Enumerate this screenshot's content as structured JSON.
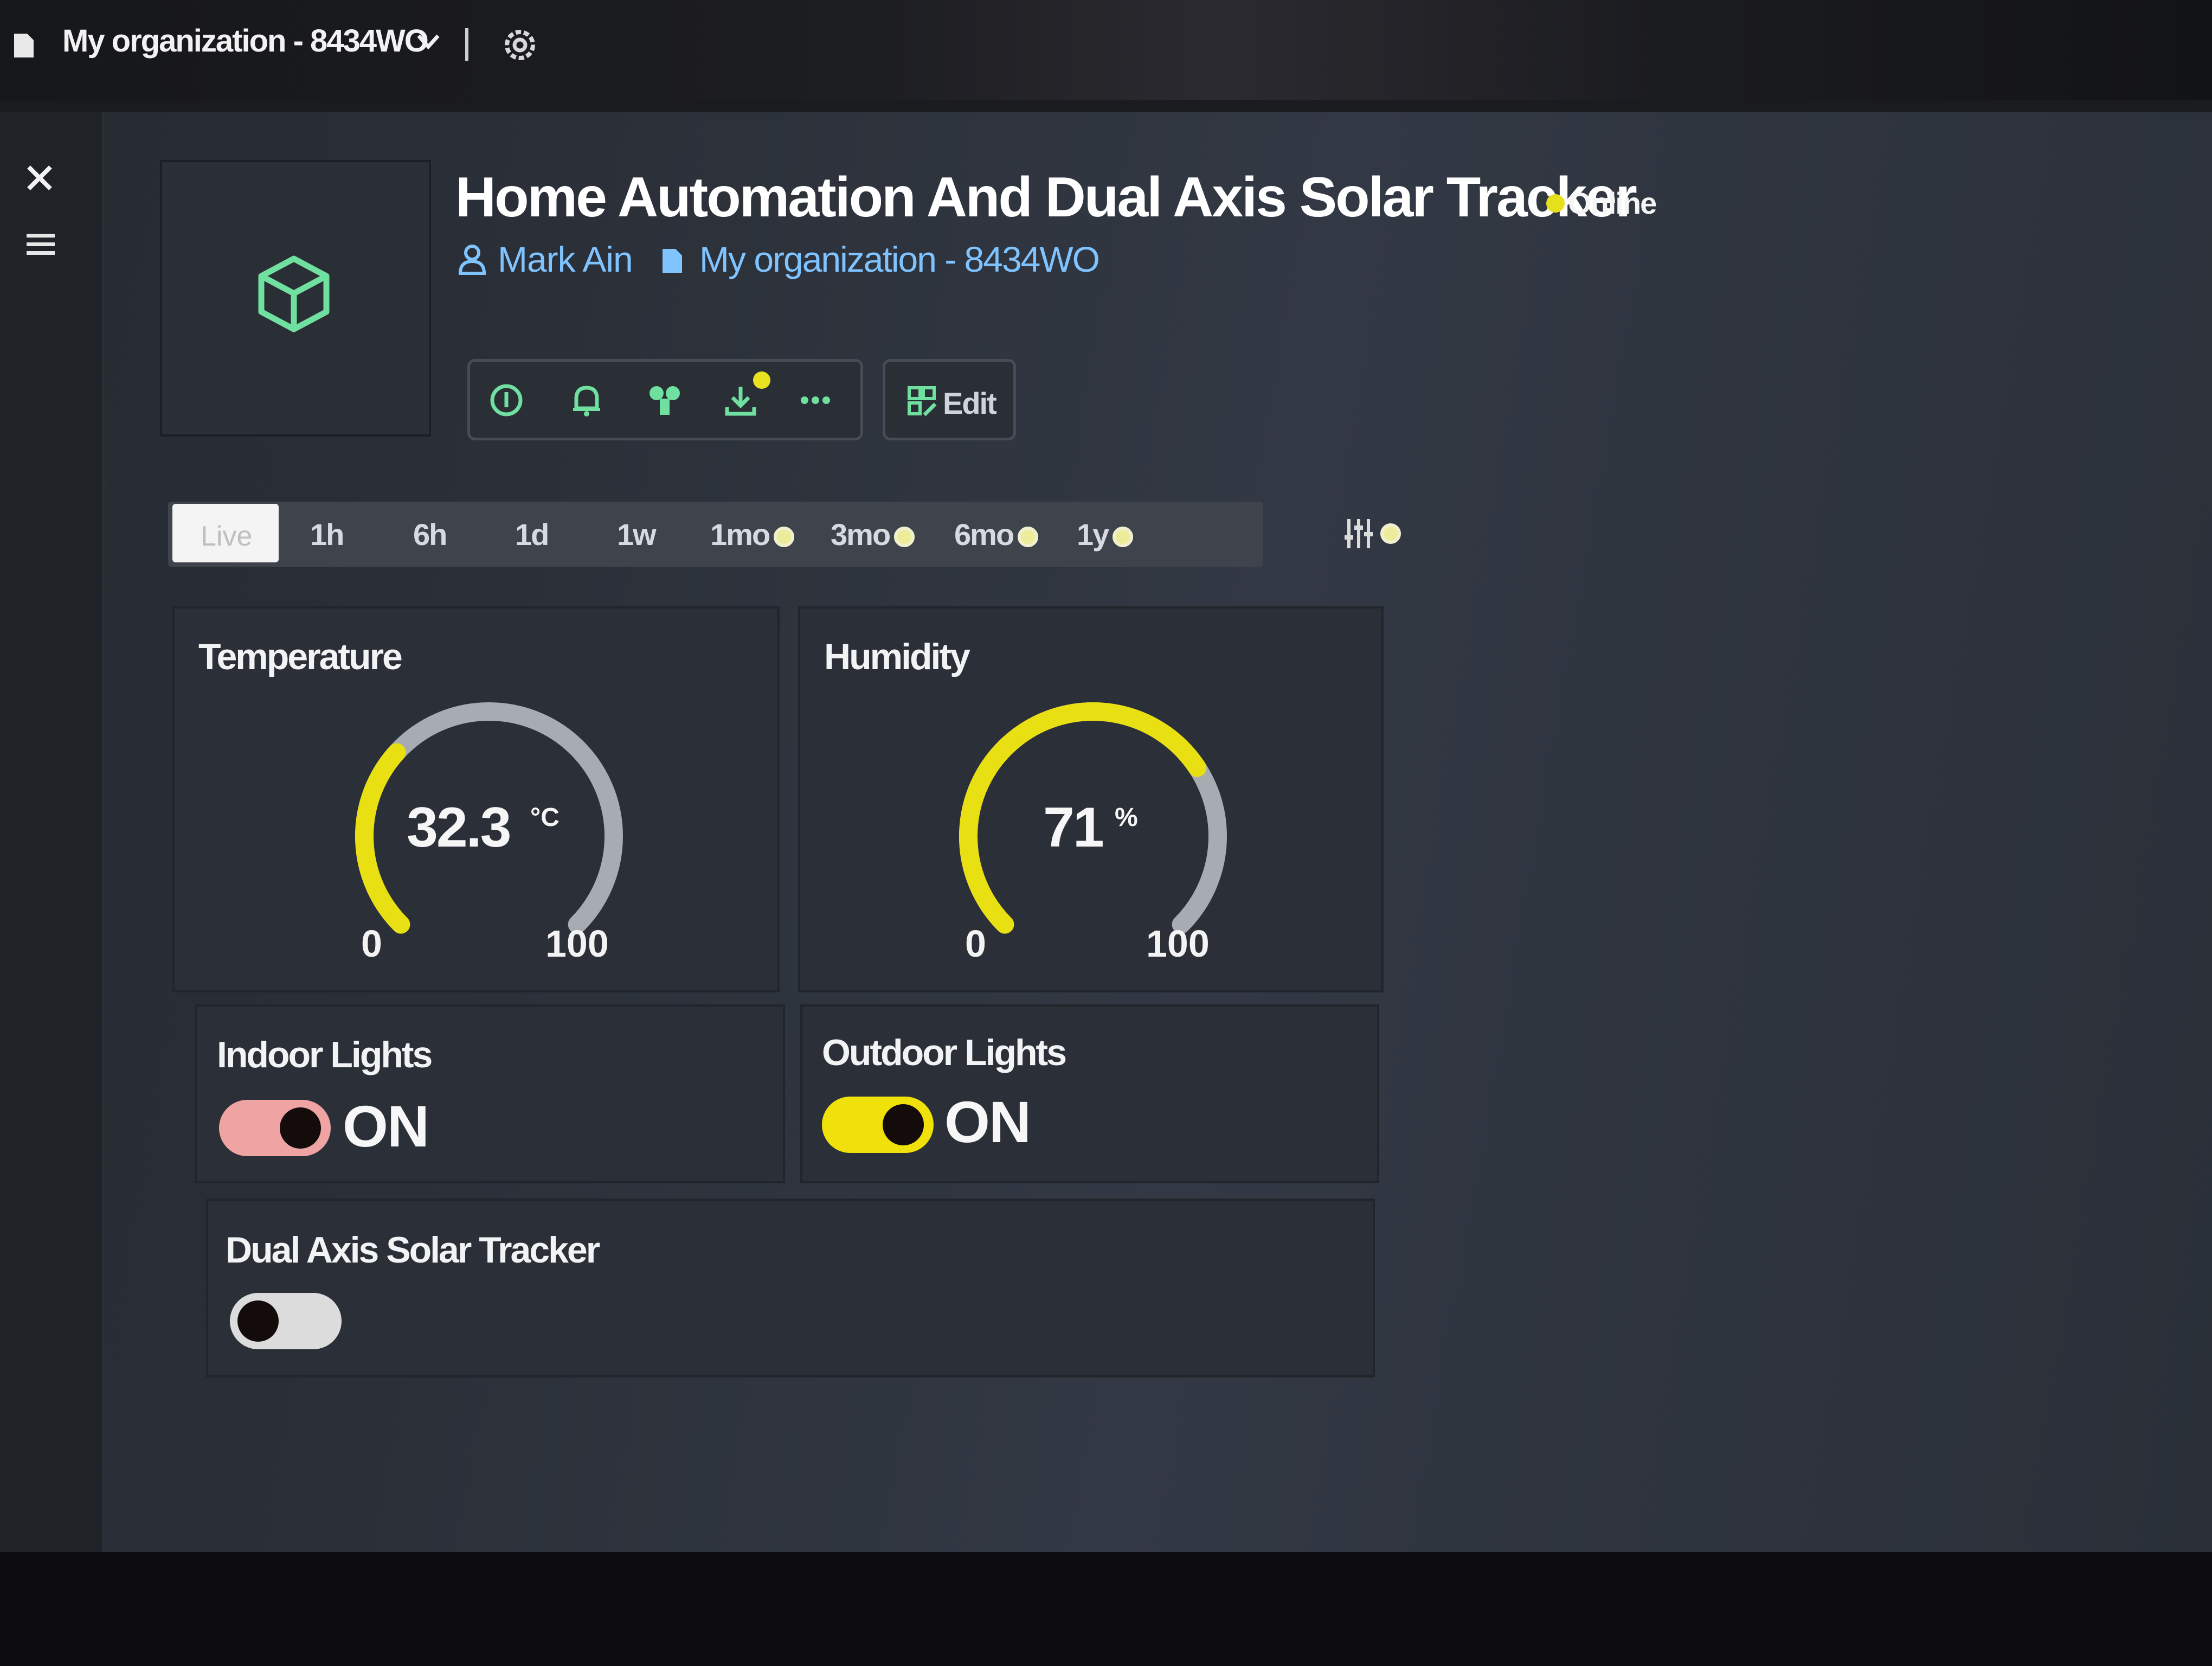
{
  "header": {
    "org_label": "My organization - 8434WO"
  },
  "device": {
    "title": "Home Automation And Dual Axis Solar Tracker",
    "status": "Online",
    "owner": "Mark Ain",
    "organization": "My organization - 8434WO"
  },
  "toolbar": {
    "edit_label": "Edit",
    "icons": [
      "info-icon",
      "bell-icon",
      "puzzle-icon",
      "download-icon",
      "more-icon"
    ]
  },
  "time_range": {
    "live": "Live",
    "ranges": [
      "1h",
      "6h",
      "1d",
      "1w",
      "1mo",
      "3mo",
      "6mo",
      "1y"
    ]
  },
  "widgets": {
    "temperature": {
      "title": "Temperature",
      "value": "32.3",
      "unit": "°C",
      "min": "0",
      "max": "100",
      "fraction": 0.323
    },
    "humidity": {
      "title": "Humidity",
      "value": "71",
      "unit": "%",
      "min": "0",
      "max": "100",
      "fraction": 0.71
    },
    "indoor_lights": {
      "title": "Indoor Lights",
      "state": "ON"
    },
    "outdoor_lights": {
      "title": "Outdoor Lights",
      "state": "ON"
    },
    "solar_tracker": {
      "title": "Dual Axis Solar Tracker",
      "state": "off"
    }
  },
  "colors": {
    "accent_yellow": "#e9e014",
    "gauge_track": "#a7abb2",
    "online_dot": "#e6e01c",
    "link_blue": "#7fc3ff",
    "icon_green": "#6fe0a0",
    "indoor_toggle": "#f0a3a3",
    "outdoor_toggle": "#f0e10a"
  }
}
